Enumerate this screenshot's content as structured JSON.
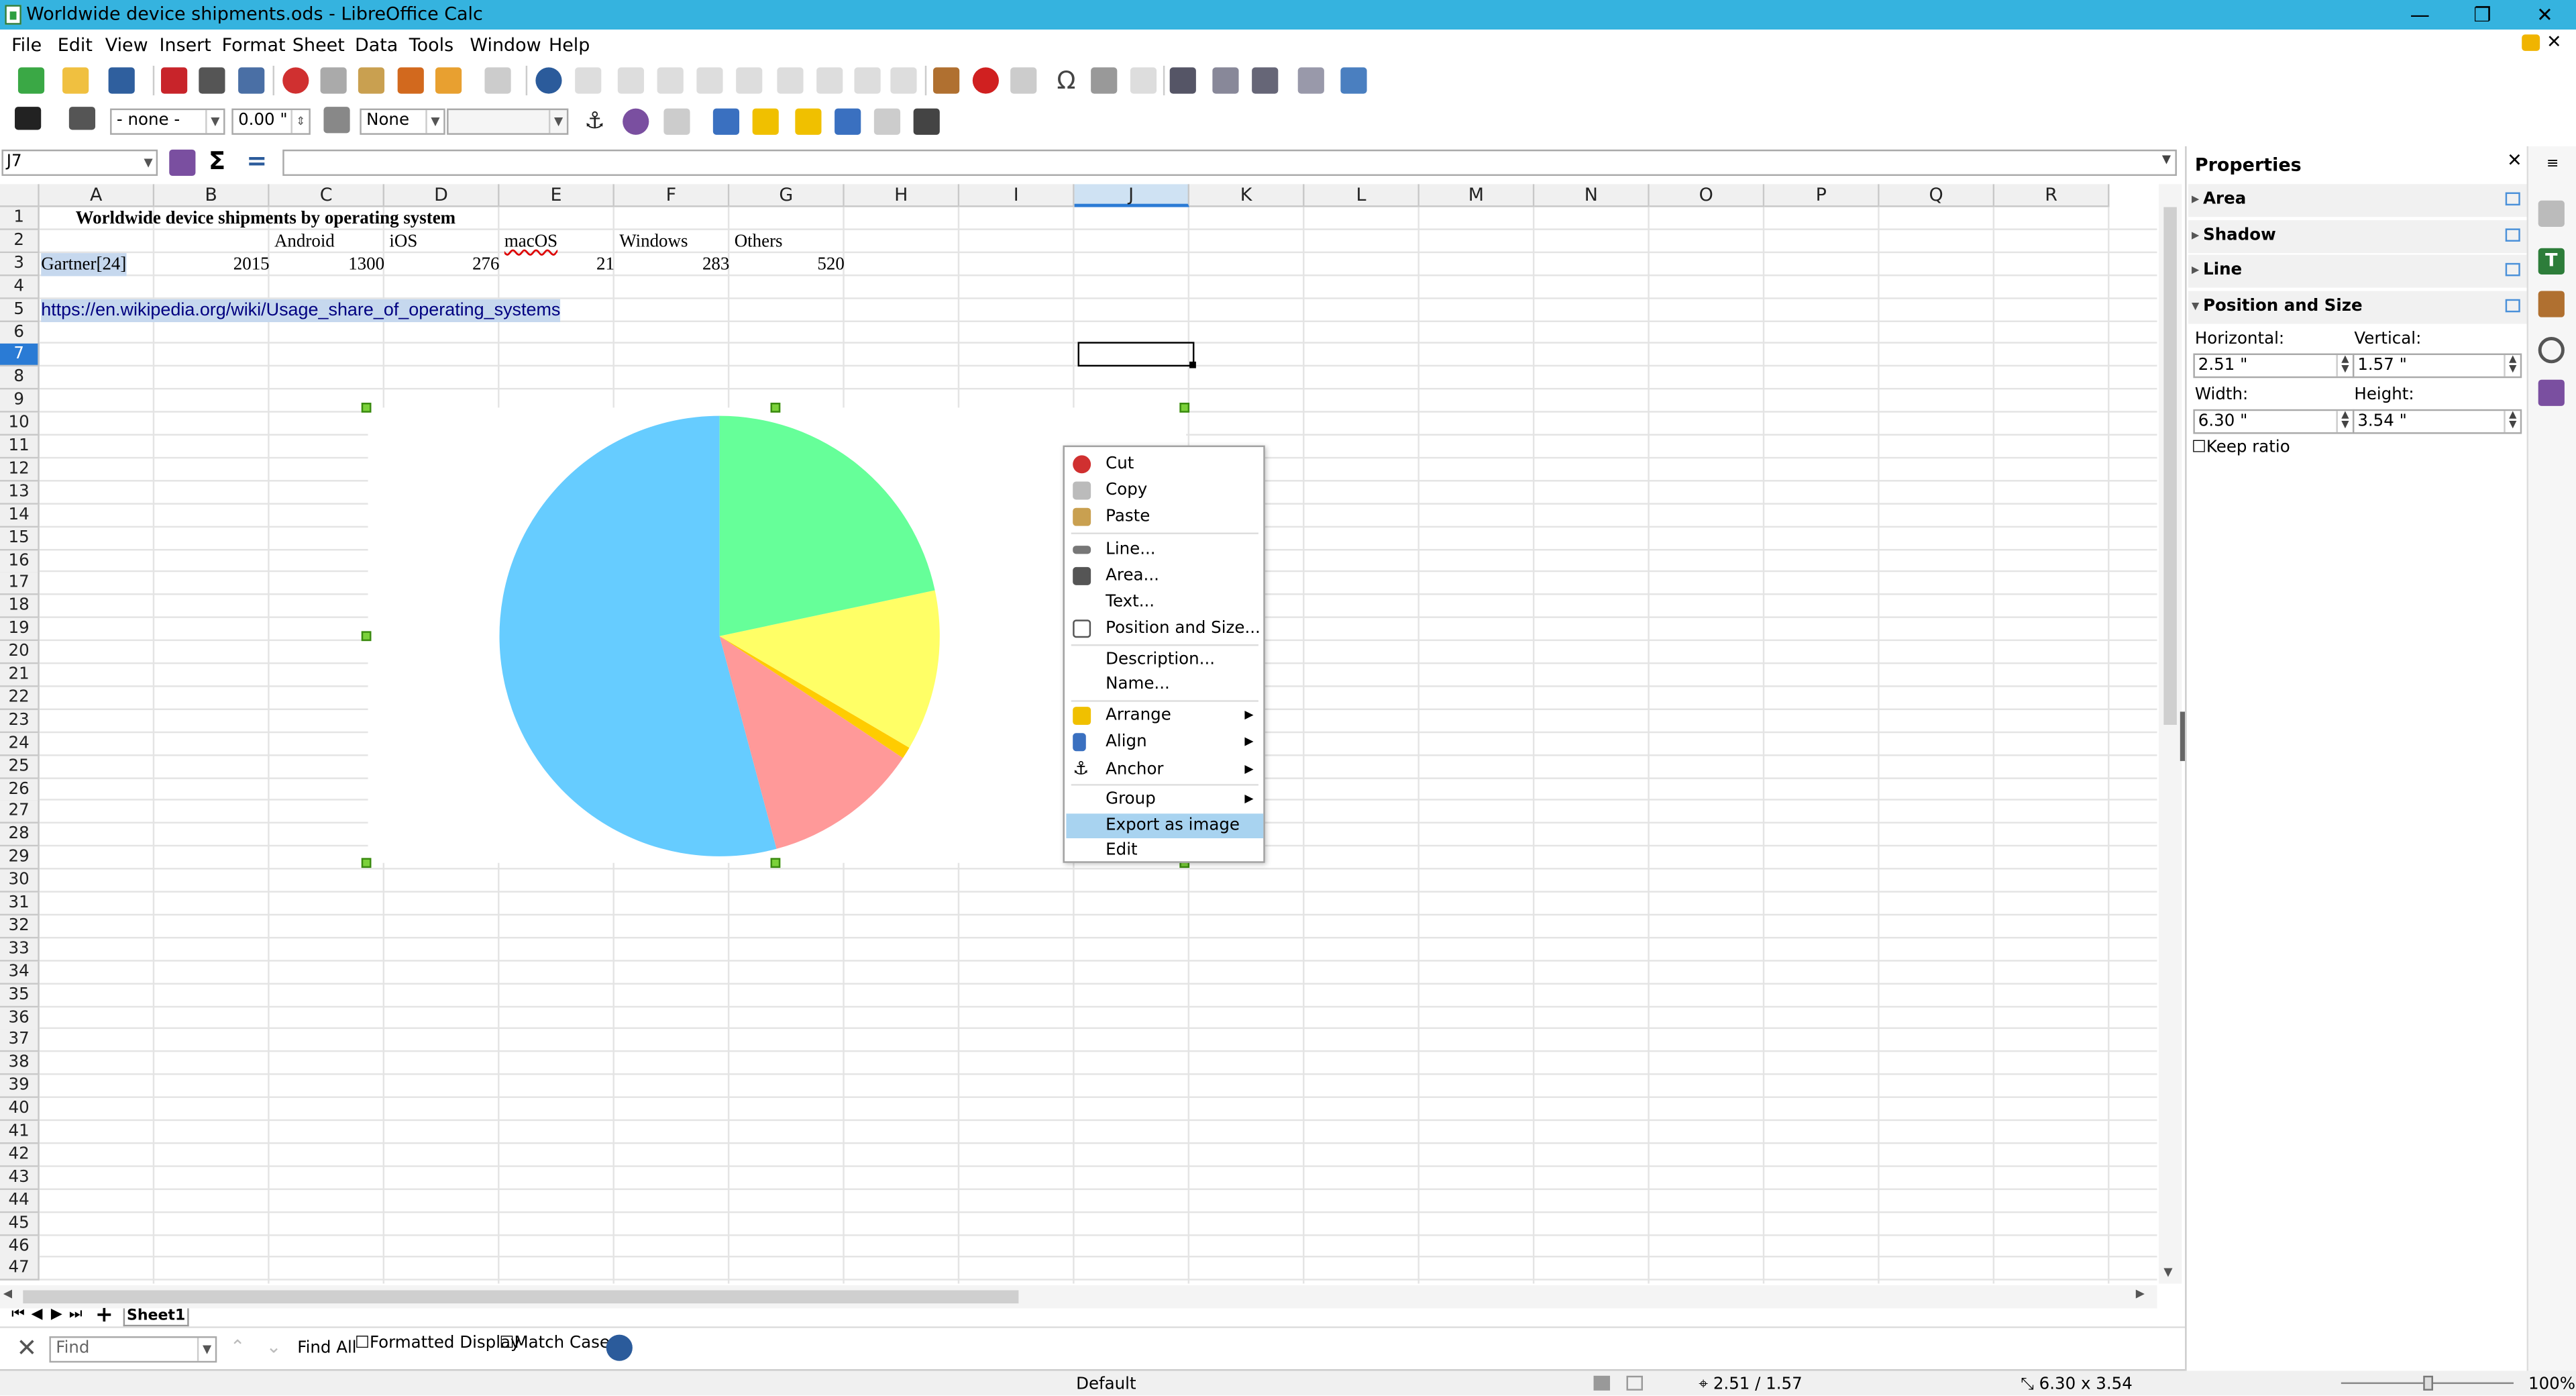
{
  "window": {
    "title": "Worldwide device shipments.ods - LibreOffice Calc",
    "minimize": "—",
    "restore": "❐",
    "close": "✕"
  },
  "menu": [
    "File",
    "Edit",
    "View",
    "Insert",
    "Format",
    "Sheet",
    "Data",
    "Tools",
    "Window",
    "Help"
  ],
  "toolbar2": {
    "line_style": "- none -",
    "line_width": "0.00 \"",
    "area_style": "None",
    "area_fill": ""
  },
  "formula_bar": {
    "name_box": "J7",
    "formula": ""
  },
  "columns": [
    "A",
    "B",
    "C",
    "D",
    "E",
    "F",
    "G",
    "H",
    "I",
    "J",
    "K",
    "L",
    "M",
    "N",
    "O",
    "P",
    "Q",
    "R"
  ],
  "selected_column": "J",
  "selected_row": "7",
  "rows": [
    "1",
    "2",
    "3",
    "4",
    "5",
    "6",
    "7",
    "8",
    "9",
    "10",
    "11",
    "12",
    "13",
    "14",
    "15",
    "16",
    "17",
    "18",
    "19",
    "20",
    "21",
    "22",
    "23",
    "24",
    "25",
    "26",
    "27",
    "28",
    "29",
    "30",
    "31",
    "32",
    "33",
    "34",
    "35",
    "36",
    "37",
    "38",
    "39",
    "40",
    "41",
    "42",
    "43",
    "44",
    "45",
    "46",
    "47"
  ],
  "cells": {
    "title": "Worldwide device shipments by operating system",
    "headers": [
      "Android",
      "iOS",
      "macOS",
      "Windows",
      "Others"
    ],
    "source": "Gartner[24]",
    "year": "2015",
    "values": [
      "1300",
      "276",
      "21",
      "283",
      "520"
    ],
    "link": "https://en.wikipedia.org/wiki/Usage_share_of_operating_systems"
  },
  "chart_data": {
    "type": "pie",
    "categories": [
      "Android",
      "iOS",
      "macOS",
      "Windows",
      "Others"
    ],
    "values": [
      1300,
      276,
      21,
      283,
      520
    ],
    "colors": [
      "#66ccff",
      "#ff9999",
      "#ffcc00",
      "#ffff66",
      "#66ff99"
    ]
  },
  "context_menu": {
    "items": [
      {
        "label": "Cut",
        "icon": "scissors-icon"
      },
      {
        "label": "Copy",
        "icon": "copy-icon"
      },
      {
        "label": "Paste",
        "icon": "paste-icon"
      },
      {
        "label": "Line...",
        "icon": "line-icon"
      },
      {
        "label": "Area...",
        "icon": "area-icon"
      },
      {
        "label": "Text...",
        "icon": ""
      },
      {
        "label": "Position and Size...",
        "icon": "position-size-icon"
      },
      {
        "label": "Description...",
        "icon": ""
      },
      {
        "label": "Name...",
        "icon": ""
      },
      {
        "label": "Arrange",
        "icon": "arrange-icon"
      },
      {
        "label": "Align",
        "icon": "align-icon"
      },
      {
        "label": "Anchor",
        "icon": "anchor-icon"
      },
      {
        "label": "Group",
        "icon": ""
      },
      {
        "label": "Export as image",
        "icon": ""
      },
      {
        "label": "Edit",
        "icon": ""
      }
    ],
    "highlighted": "Export as image"
  },
  "sidebar": {
    "title": "Properties",
    "sections": [
      "Area",
      "Shadow",
      "Line",
      "Position and Size"
    ],
    "horizontal_label": "Horizontal:",
    "horizontal": "2.51 \"",
    "vertical_label": "Vertical:",
    "vertical": "1.57 \"",
    "width_label": "Width:",
    "width": "6.30 \"",
    "height_label": "Height:",
    "height": "3.54 \"",
    "keep_ratio": "Keep ratio"
  },
  "sheet_tab": "Sheet1",
  "findbar": {
    "placeholder": "Find",
    "find_all": "Find All",
    "formatted_display": "Formatted Display",
    "match_case": "Match Case"
  },
  "status": {
    "page_style": "Default",
    "position": "2.51 / 1.57",
    "size": "6.30 x 3.54",
    "zoom": "100%"
  }
}
